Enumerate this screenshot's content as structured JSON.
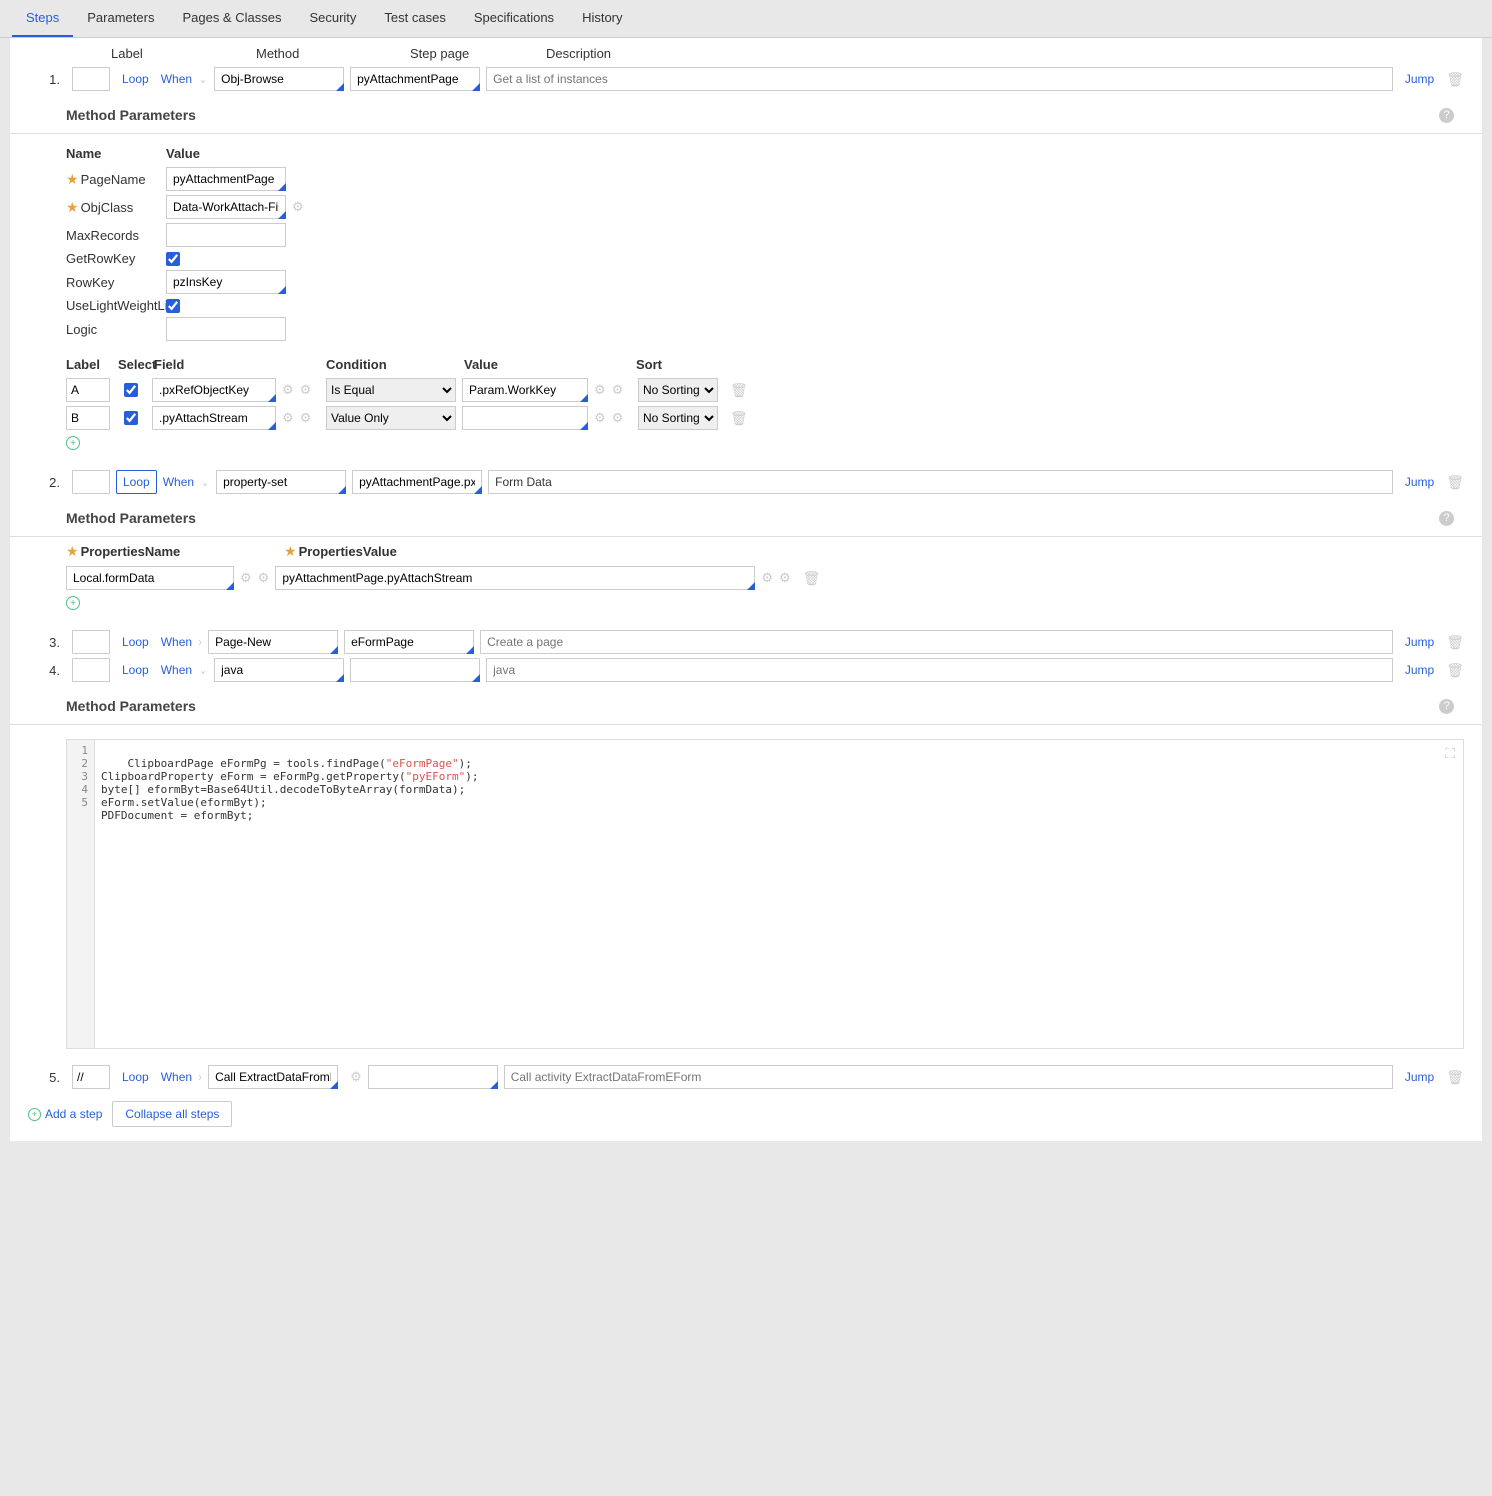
{
  "tabs": [
    "Steps",
    "Parameters",
    "Pages & Classes",
    "Security",
    "Test cases",
    "Specifications",
    "History"
  ],
  "activeTab": 0,
  "stepHeaders": {
    "label": "Label",
    "method": "Method",
    "steppage": "Step page",
    "description": "Description"
  },
  "steps": [
    {
      "num": "1.",
      "label": "",
      "loop": "Loop",
      "when": "When",
      "method": "Obj-Browse",
      "steppage": "pyAttachmentPage",
      "desc": "Get a list of instances",
      "descPlaceholder": true,
      "jump": "Jump"
    },
    {
      "num": "2.",
      "label": "",
      "loop": "Loop",
      "loopBoxed": true,
      "when": "When",
      "method": "property-set",
      "steppage": "pyAttachmentPage.pxResu",
      "desc": "Form Data",
      "descPlaceholder": false,
      "jump": "Jump"
    },
    {
      "num": "3.",
      "label": "",
      "loop": "Loop",
      "when": "When",
      "method": "Page-New",
      "steppage": "eFormPage",
      "desc": "Create a page",
      "descPlaceholder": true,
      "jump": "Jump"
    },
    {
      "num": "4.",
      "label": "",
      "loop": "Loop",
      "when": "When",
      "method": "java",
      "steppage": "",
      "desc": "java",
      "descPlaceholder": true,
      "jump": "Jump"
    },
    {
      "num": "5.",
      "label": "//",
      "loop": "Loop",
      "when": "When",
      "method": "Call ExtractDataFromEForm",
      "steppage": "",
      "desc": "Call activity ExtractDataFromEForm",
      "descPlaceholder": true,
      "jump": "Jump"
    }
  ],
  "mpTitle": "Method Parameters",
  "mp1": {
    "nameHdr": "Name",
    "valueHdr": "Value",
    "rows": [
      {
        "name": "PageName",
        "req": true,
        "value": "pyAttachmentPage",
        "gear": false,
        "check": null
      },
      {
        "name": "ObjClass",
        "req": true,
        "value": "Data-WorkAttach-File",
        "gear": true,
        "check": null
      },
      {
        "name": "MaxRecords",
        "req": false,
        "value": "",
        "gear": false,
        "check": null
      },
      {
        "name": "GetRowKey",
        "req": false,
        "value": null,
        "gear": false,
        "check": true
      },
      {
        "name": "RowKey",
        "req": false,
        "value": "pzInsKey",
        "gear": false,
        "check": null
      },
      {
        "name": "UseLightWeightList",
        "req": false,
        "value": null,
        "gear": false,
        "check": true
      },
      {
        "name": "Logic",
        "req": false,
        "value": "",
        "gear": false,
        "check": null
      }
    ]
  },
  "browseHdr": {
    "label": "Label",
    "select": "Select",
    "field": "Field",
    "condition": "Condition",
    "value": "Value",
    "sort": "Sort"
  },
  "browseRows": [
    {
      "label": "A",
      "select": true,
      "field": ".pxRefObjectKey",
      "condition": "Is Equal",
      "value": "Param.WorkKey",
      "sort": "No Sorting"
    },
    {
      "label": "B",
      "select": true,
      "field": ".pyAttachStream",
      "condition": "Value Only",
      "value": "",
      "sort": "No Sorting"
    }
  ],
  "propSet": {
    "nameHdr": "PropertiesName",
    "valueHdr": "PropertiesValue",
    "name": "Local.formData",
    "value": "pyAttachmentPage.pyAttachStream"
  },
  "codeLines": [
    {
      "n": "1",
      "code": "ClipboardPage eFormPg = tools.findPage(",
      "str": "\"eFormPage\"",
      "tail": ");"
    },
    {
      "n": "2",
      "code": "ClipboardProperty eForm = eFormPg.getProperty(",
      "str": "\"pyEForm\"",
      "tail": ");"
    },
    {
      "n": "3",
      "code": "byte[] eformByt=Base64Util.decodeToByteArray(formData);",
      "str": "",
      "tail": ""
    },
    {
      "n": "4",
      "code": "eForm.setValue(eformByt);",
      "str": "",
      "tail": ""
    },
    {
      "n": "5",
      "code": "PDFDocument = eformByt;",
      "str": "",
      "tail": ""
    }
  ],
  "footer": {
    "addStep": "Add a step",
    "collapse": "Collapse all steps"
  }
}
